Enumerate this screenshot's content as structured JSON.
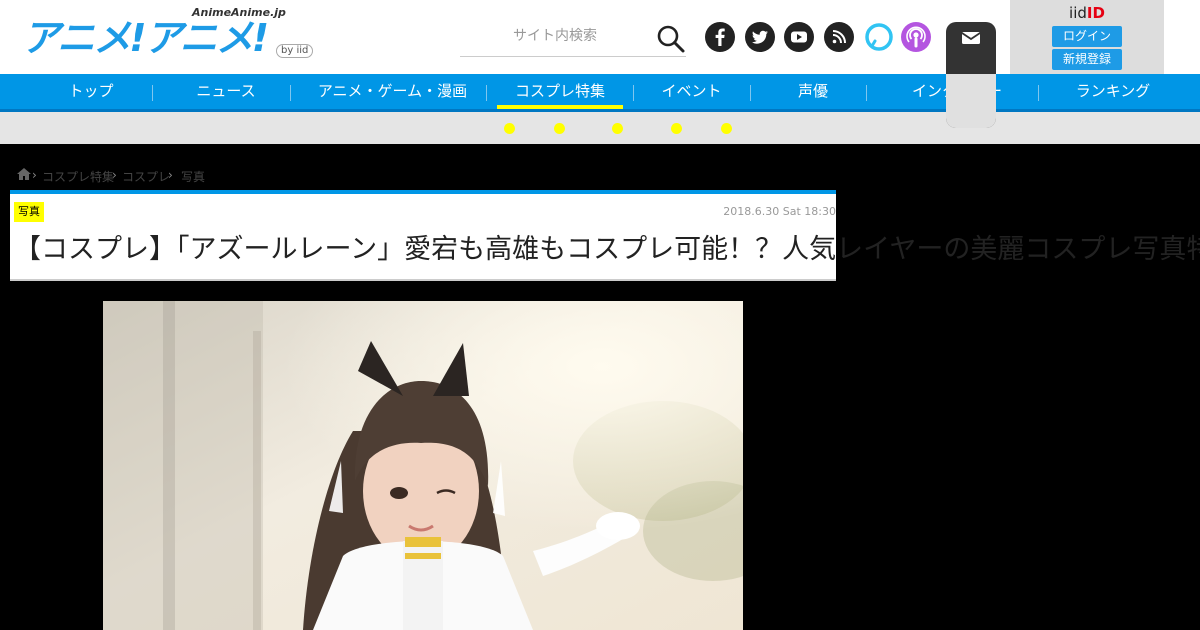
{
  "site": {
    "logo_sub": "AnimeAnime.jp",
    "logo_main": "アニメ!アニメ!",
    "logo_by": "by iid"
  },
  "search": {
    "placeholder": "サイト内検索"
  },
  "social_icons": [
    "facebook-icon",
    "twitter-icon",
    "youtube-icon",
    "rss-icon",
    "alexa-icon",
    "podcast-icon"
  ],
  "mail_icon": "mail-icon",
  "account": {
    "title_prefix": "iid",
    "title_suffix": "ID",
    "login_label": "ログイン",
    "register_label": "新規登録"
  },
  "nav": {
    "items": [
      {
        "label": "トップ"
      },
      {
        "label": "ニュース"
      },
      {
        "label": "アニメ・ゲーム・漫画"
      },
      {
        "label": "コスプレ特集"
      },
      {
        "label": "イベント"
      },
      {
        "label": "声優"
      },
      {
        "label": "インタビュー"
      },
      {
        "label": "ランキング"
      }
    ]
  },
  "breadcrumb": {
    "items": [
      "コスプレ特集",
      "コスプレ",
      "写真"
    ]
  },
  "article": {
    "category": "写真",
    "date": "2018.6.30 Sat 18:30",
    "title": "【コスプレ】「アズールレーン」愛宕も高雄もコスプレ可能！？人気レイヤーの美麗コスプレ写真特集"
  },
  "colors": {
    "brand_blue": "#0096e6",
    "highlight_yellow": "#ffff00",
    "iid_red": "#e60012"
  }
}
